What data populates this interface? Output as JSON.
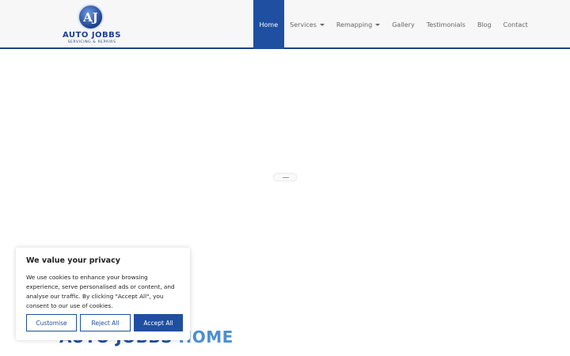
{
  "header": {
    "logo": {
      "badge": "AJ",
      "title": "AUTO JOBBS",
      "subtitle": "SERVICING & REPAIRS"
    },
    "nav": [
      {
        "label": "Home",
        "active": true
      },
      {
        "label": "Services",
        "dropdown": true
      },
      {
        "label": "Remapping",
        "dropdown": true
      },
      {
        "label": "Gallery"
      },
      {
        "label": "Testimonials"
      },
      {
        "label": "Blog"
      },
      {
        "label": "Contact"
      }
    ]
  },
  "hero": {
    "title_part1": "AUTO JOBBS ",
    "title_part2": "HOME"
  },
  "cookie": {
    "title": "We value your privacy",
    "text": "We use cookies to enhance your browsing experience, serve personalised ads or content, and analyse our traffic. By clicking \"Accept All\", you consent to our use of cookies.",
    "customise": "Customise",
    "reject": "Reject All",
    "accept": "Accept All"
  },
  "colors": {
    "brand": "#1f4fa0",
    "accent": "#4b8fd0"
  }
}
